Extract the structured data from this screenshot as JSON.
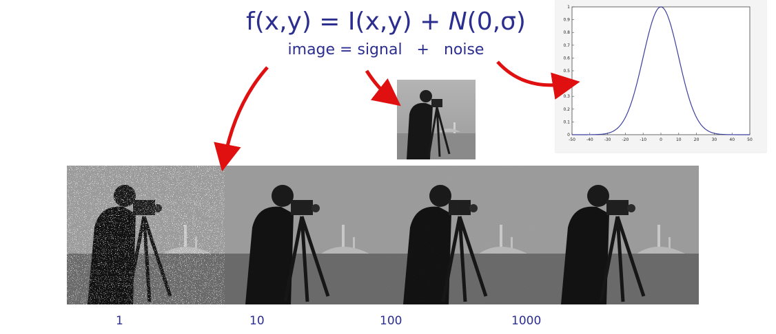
{
  "equation": {
    "prefix": "f(x,y) = I(x,y) + ",
    "noise_symbol": "N",
    "noise_args": "(0,σ)",
    "subtitle": "image = signal   +   noise"
  },
  "gaussian_plot": {
    "x_ticks": [
      "-50",
      "-40",
      "-30",
      "-20",
      "-10",
      "0",
      "10",
      "20",
      "30",
      "40",
      "50"
    ],
    "y_ticks": [
      "0",
      "0.1",
      "0.2",
      "0.3",
      "0.4",
      "0.5",
      "0.6",
      "0.7",
      "0.8",
      "0.9",
      "1"
    ]
  },
  "noise_levels": [
    {
      "label": "1"
    },
    {
      "label": "10"
    },
    {
      "label": "100"
    },
    {
      "label": "1000"
    }
  ],
  "colors": {
    "text": "#2b2e8f",
    "arrow": "#e01010",
    "curve": "#3a3f9e"
  },
  "chart_data": {
    "type": "line",
    "x": [
      -50,
      -40,
      -30,
      -20,
      -10,
      0,
      10,
      20,
      30,
      40,
      50
    ],
    "series": [
      {
        "values": [
          0,
          0.001,
          0.01,
          0.135,
          0.607,
          1,
          0.607,
          0.135,
          0.01,
          0.001,
          0
        ]
      }
    ],
    "xlim": [
      -50,
      50
    ],
    "ylim": [
      0,
      1
    ]
  }
}
